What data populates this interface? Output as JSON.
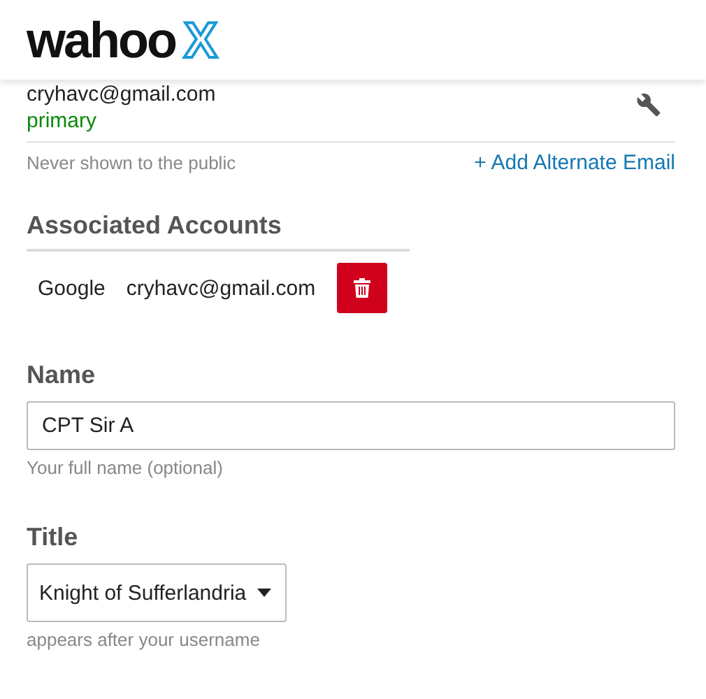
{
  "header": {
    "logo_word": "wahoo",
    "logo_mark": "X"
  },
  "email": {
    "address": "cryhavc@gmail.com",
    "status": "primary",
    "note": "Never shown to the public",
    "add_link": "+ Add Alternate Email"
  },
  "associated_accounts": {
    "heading": "Associated Accounts",
    "accounts": [
      {
        "provider": "Google",
        "email": "cryhavc@gmail.com"
      }
    ]
  },
  "fields": [
    {
      "kind": "input",
      "label": "Name",
      "value": "CPT Sir A",
      "hint": "Your full name (optional)"
    },
    {
      "kind": "select",
      "label": "Title",
      "value": "Knight of Sufferlandria",
      "hint": "appears after your username"
    }
  ]
}
